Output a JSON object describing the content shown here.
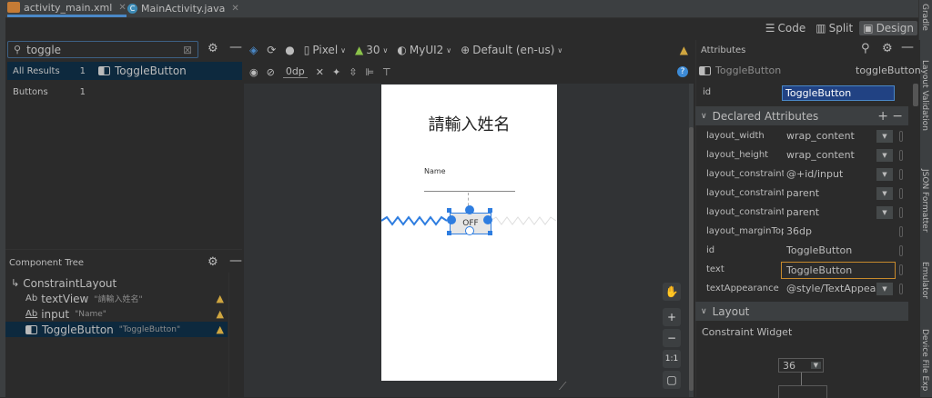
{
  "tabs": [
    {
      "label": "activity_main.xml",
      "active": true
    },
    {
      "label": "MainActivity.java",
      "active": false
    }
  ],
  "view_modes": {
    "code": "Code",
    "split": "Split",
    "design": "Design"
  },
  "palette": {
    "search_value": "toggle",
    "categories": [
      {
        "label": "All Results",
        "count": "1"
      },
      {
        "label": "Buttons",
        "count": "1"
      }
    ],
    "result_item": "ToggleButton"
  },
  "component_tree": {
    "title": "Component Tree",
    "rows": [
      {
        "label": "ConstraintLayout",
        "sub": ""
      },
      {
        "label": "textView",
        "sub": "\"請輸入姓名\""
      },
      {
        "label": "input",
        "sub": "\"Name\""
      },
      {
        "label": "ToggleButton",
        "sub": "\"ToggleButton\""
      }
    ]
  },
  "toolbar": {
    "device": "Pixel",
    "api": "30",
    "theme": "MyUI2",
    "locale": "Default (en-us)",
    "margin": "0dp"
  },
  "canvas": {
    "title_text": "請輸入姓名",
    "name_hint": "Name",
    "toggle_text": "OFF"
  },
  "float_buttons": {
    "zoom_reset": "1:1"
  },
  "attributes": {
    "header": "Attributes",
    "widget_type": "ToggleButton",
    "widget_id": "toggleButton",
    "id_label": "id",
    "id_value": "ToggleButton",
    "declared_header": "Declared Attributes",
    "declared": [
      {
        "key": "layout_width",
        "value": "wrap_content",
        "dropdown": true
      },
      {
        "key": "layout_height",
        "value": "wrap_content",
        "dropdown": true
      },
      {
        "key": "layout_constraint...",
        "value": "@+id/input",
        "dropdown": true
      },
      {
        "key": "layout_constraint...",
        "value": "parent",
        "dropdown": true
      },
      {
        "key": "layout_constraint...",
        "value": "parent",
        "dropdown": true
      },
      {
        "key": "layout_marginTop",
        "value": "36dp",
        "dropdown": false
      },
      {
        "key": "id",
        "value": "ToggleButton",
        "dropdown": false
      },
      {
        "key": "text",
        "value": "ToggleButton",
        "dropdown": false
      },
      {
        "key": "textAppearance",
        "value": "@style/TextAppea",
        "dropdown": true
      }
    ],
    "layout_header": "Layout",
    "constraint_widget_label": "Constraint Widget",
    "margin_value": "36"
  },
  "right_strip": [
    "Gradle",
    "Layout Validation",
    "JSON Formatter",
    "Emulator",
    "Device File Exp"
  ],
  "colors": {
    "accent": "#4a88c7",
    "warning": "#d0a640",
    "selection": "#0d293e",
    "blueprint": "#2e7de0"
  }
}
